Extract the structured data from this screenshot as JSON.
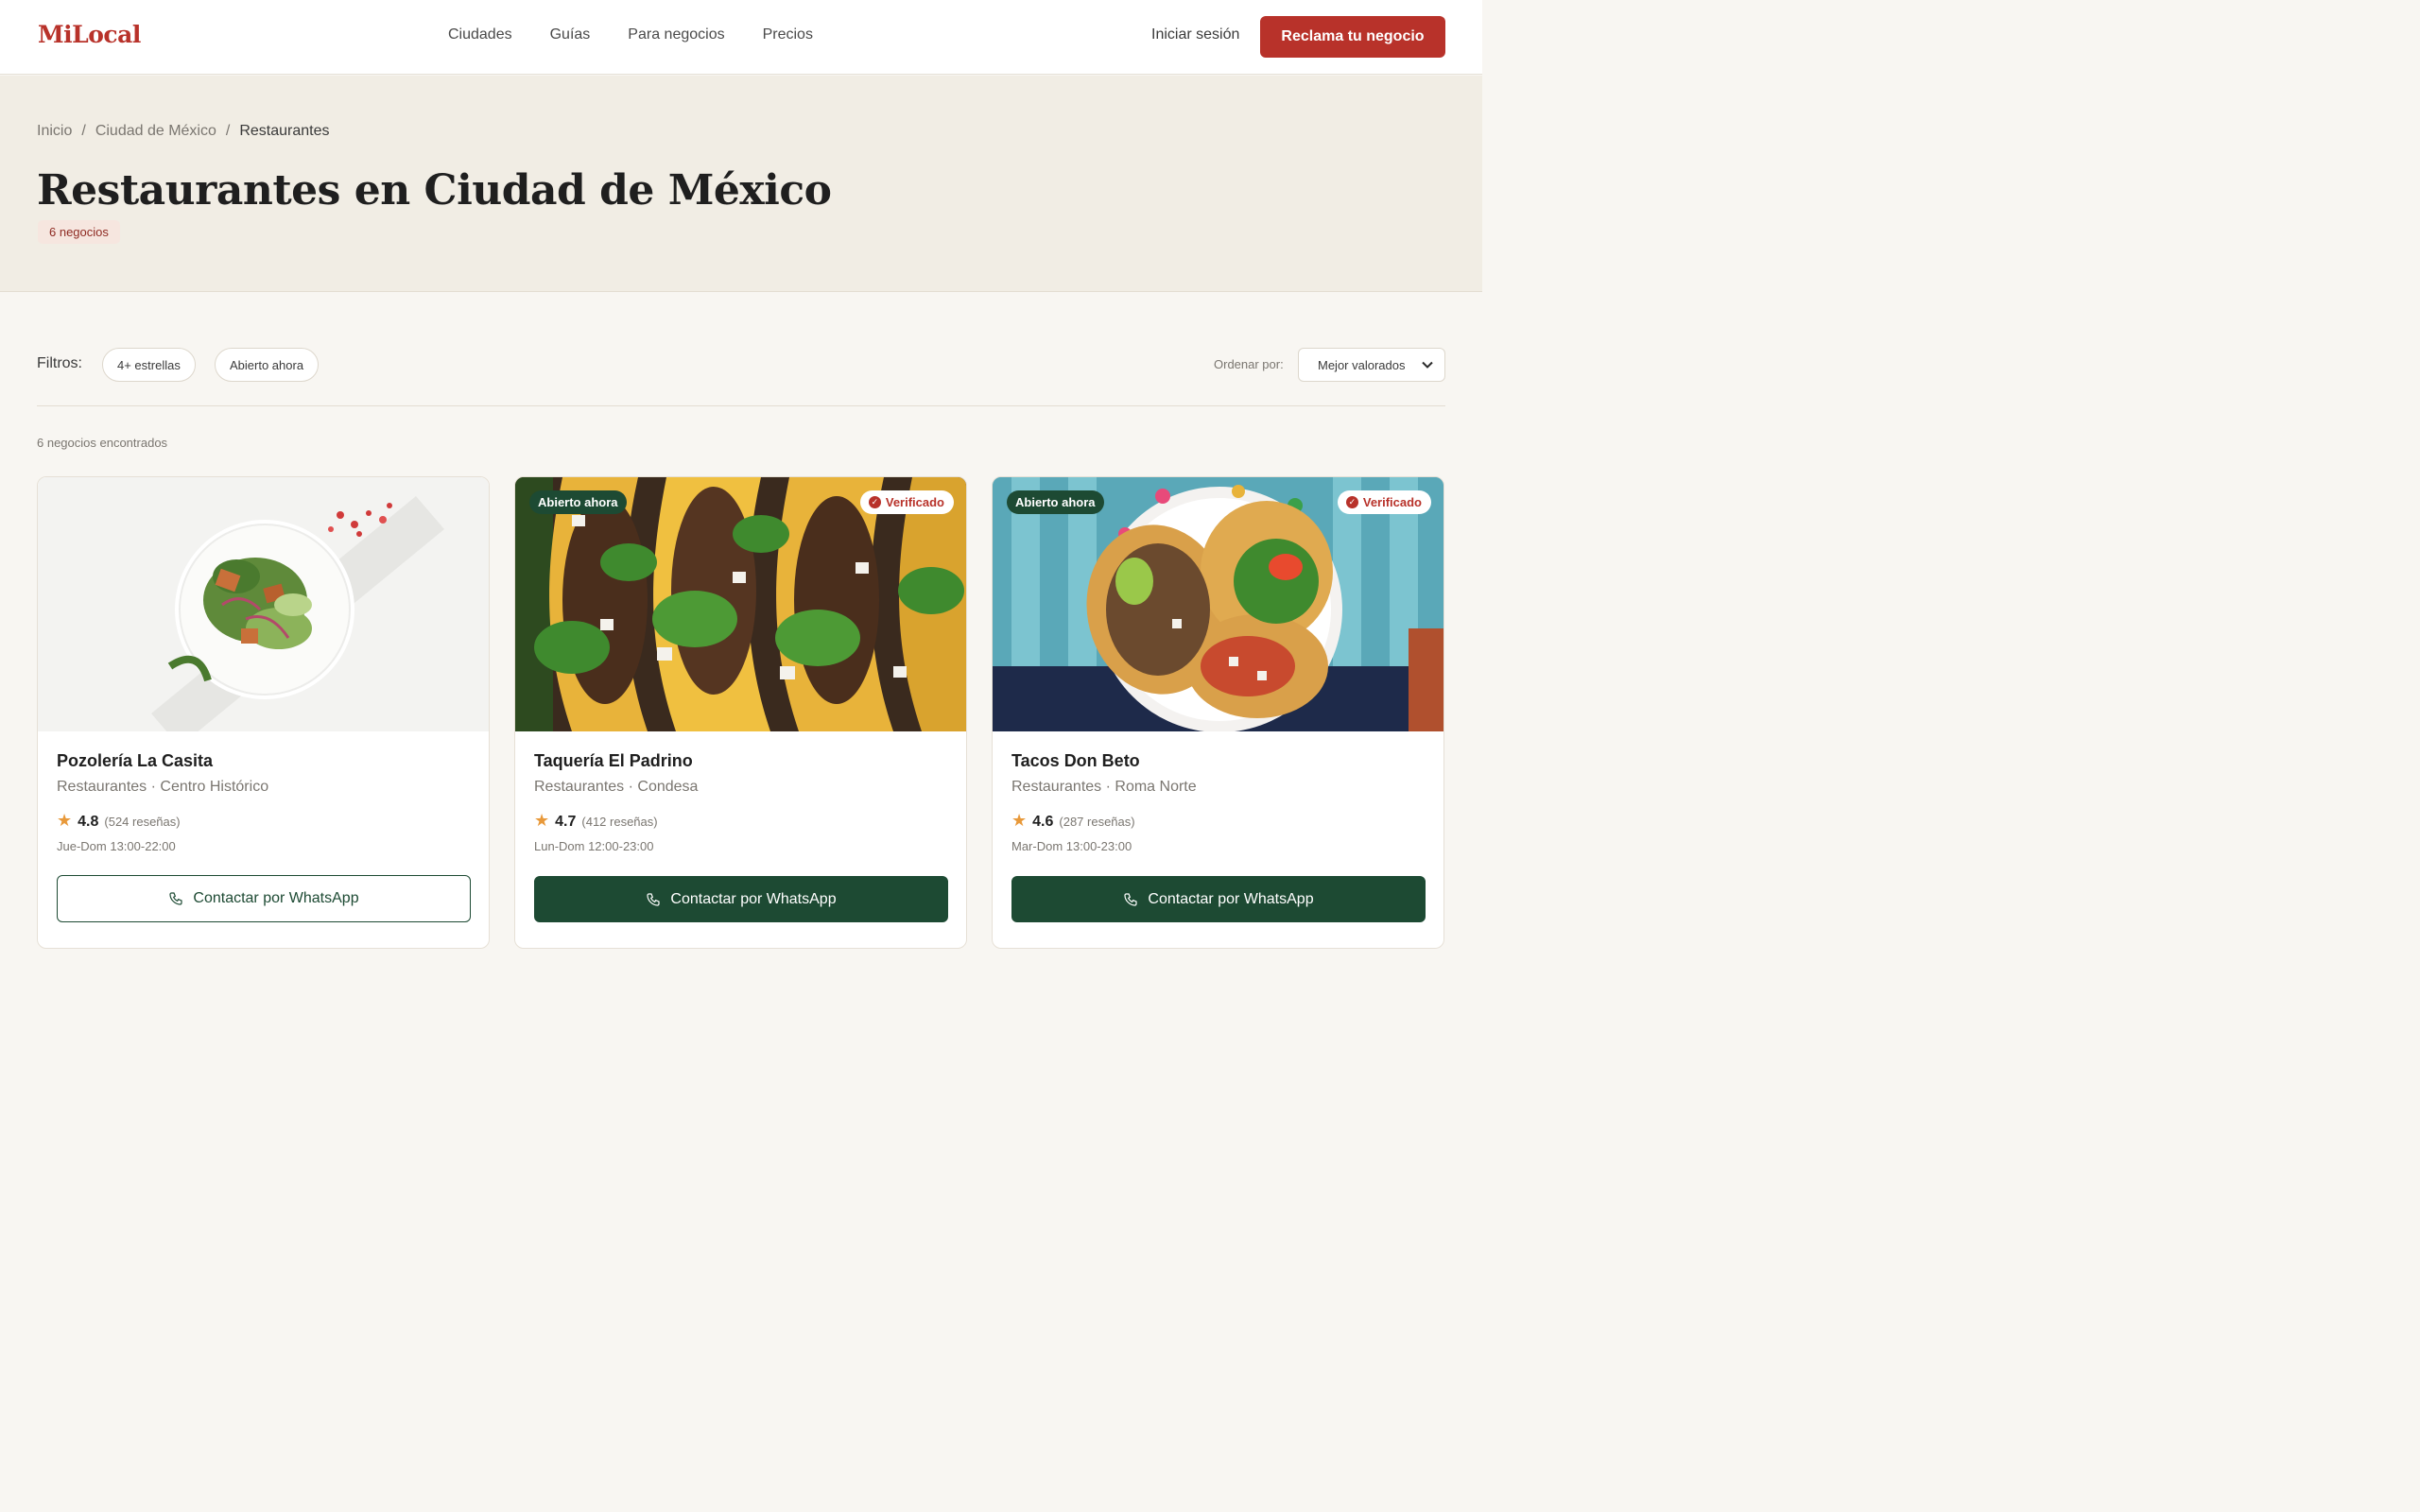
{
  "header": {
    "logo": "MiLocal",
    "nav": [
      "Ciudades",
      "Guías",
      "Para negocios",
      "Precios"
    ],
    "login": "Iniciar sesión",
    "cta": "Reclama tu negocio"
  },
  "hero": {
    "breadcrumb": [
      "Inicio",
      "Ciudad de México",
      "Restaurantes"
    ],
    "separator": "/",
    "title": "Restaurantes en Ciudad de México",
    "count_badge": "6 negocios"
  },
  "filters": {
    "label": "Filtros:",
    "chips": [
      "4+ estrellas",
      "Abierto ahora"
    ],
    "sort_label": "Ordenar por:",
    "sort_value": "Mejor valorados"
  },
  "results_count": "6 negocios encontrados",
  "badges": {
    "open": "Abierto ahora",
    "verified": "Verificado"
  },
  "cards": [
    {
      "name": "Pozolería La Casita",
      "category": "Restaurantes · Centro Histórico",
      "rating": "4.8",
      "reviews": "(524 reseñas)",
      "hours": "Jue-Dom 13:00-22:00",
      "cta": "Contactar por WhatsApp",
      "open_now": false,
      "verified": false
    },
    {
      "name": "Taquería El Padrino",
      "category": "Restaurantes · Condesa",
      "rating": "4.7",
      "reviews": "(412 reseñas)",
      "hours": "Lun-Dom 12:00-23:00",
      "cta": "Contactar por WhatsApp",
      "open_now": true,
      "verified": true
    },
    {
      "name": "Tacos Don Beto",
      "category": "Restaurantes · Roma Norte",
      "rating": "4.6",
      "reviews": "(287 reseñas)",
      "hours": "Mar-Dom 13:00-23:00",
      "cta": "Contactar por WhatsApp",
      "open_now": true,
      "verified": true
    }
  ],
  "colors": {
    "brand": "#b8322a",
    "green": "#1d4a33",
    "hero_bg": "#f1ede4",
    "page_bg": "#f8f6f2",
    "star": "#e8993a"
  }
}
